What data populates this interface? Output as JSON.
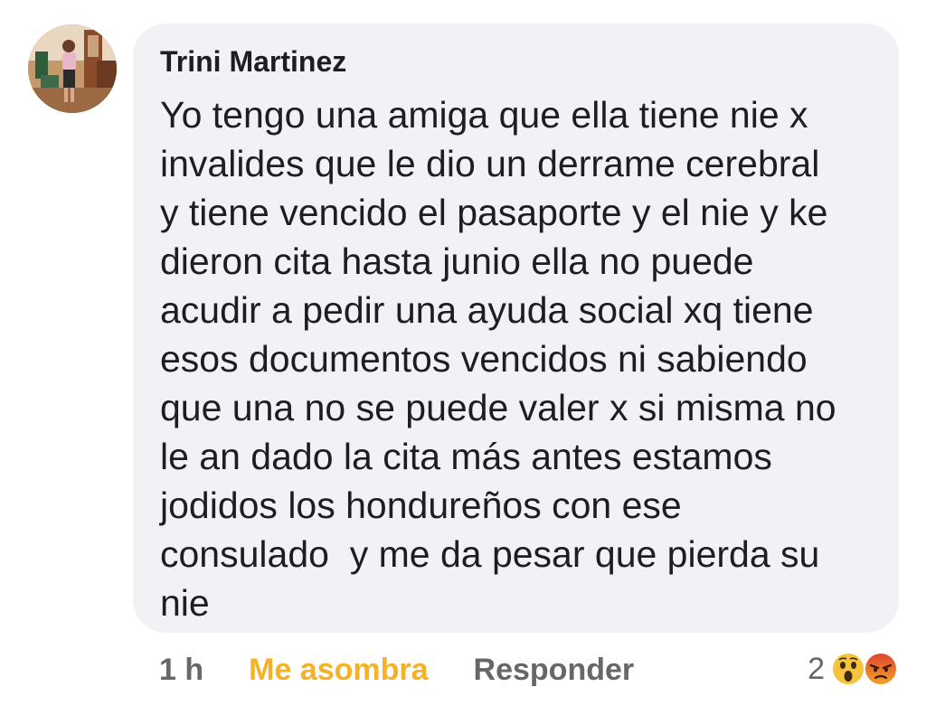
{
  "comment": {
    "author": "Trini Martinez",
    "body_lines": [
      "Yo tengo una amiga que ella tiene nie x",
      "invalides que le dio un derrame cerebral",
      "y tiene vencido el pasaporte y el nie y ke",
      "dieron cita hasta junio ella no puede",
      "acudir a pedir una ayuda social xq tiene",
      "esos documentos vencidos ni sabiendo",
      "que una no se puede valer x si misma no",
      "le an dado la cita más antes estamos",
      "jodidos los hondureños con ese",
      "consulado  y me da pesar que pierda su",
      "nie"
    ],
    "time": "1 h",
    "reaction_label": "Me asombra",
    "reply_label": "Responder",
    "reaction_count": "2",
    "reaction_icons": [
      "wow-emoji-icon",
      "angry-emoji-icon"
    ]
  },
  "colors": {
    "bubble": "#f0f2f5",
    "text": "#1c1e21",
    "muted": "#65676b",
    "wow_reaction": "#f7b125",
    "angry_reaction": "#e9710f"
  }
}
